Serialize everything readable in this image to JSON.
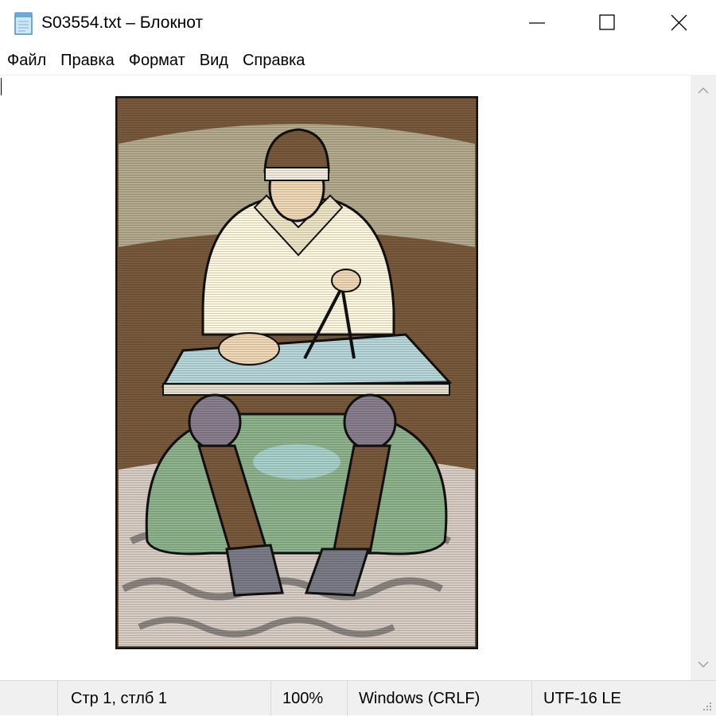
{
  "window": {
    "title": "S03554.txt – Блокнот",
    "icon": "notepad-icon",
    "controls": [
      "minimize-icon",
      "maximize-icon",
      "close-icon"
    ]
  },
  "menu": {
    "items": [
      "Файл",
      "Правка",
      "Формат",
      "Вид",
      "Справка"
    ]
  },
  "editor": {
    "content_image": "clipart-man-drafting-with-compass"
  },
  "statusbar": {
    "position": "Стр 1, стлб 1",
    "zoom": "100%",
    "line_endings": "Windows (CRLF)",
    "encoding": "UTF-16 LE"
  },
  "colors": {
    "background": "#ffffff",
    "chrome": "#f0f0f0",
    "picture_brown": "#7a5a3c",
    "picture_stone": "#b5ab8f",
    "picture_green": "#8fb48e"
  }
}
